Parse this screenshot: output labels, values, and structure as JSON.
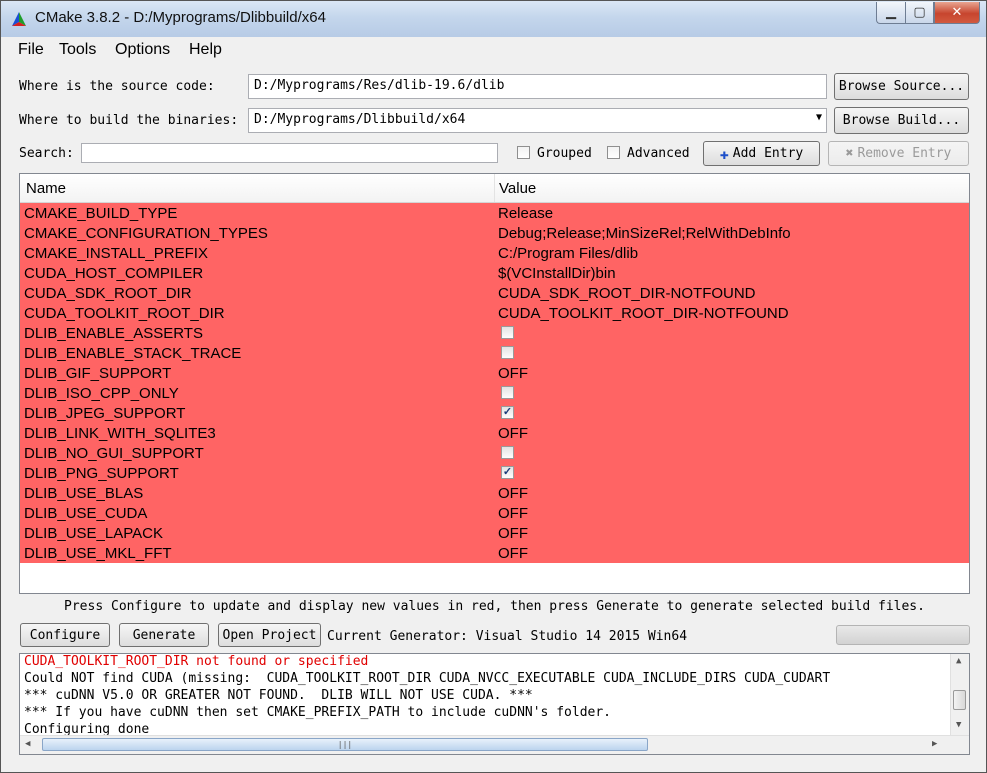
{
  "window": {
    "title": "CMake 3.8.2 - D:/Myprograms/Dlibbuild/x64"
  },
  "menu": [
    "File",
    "Tools",
    "Options",
    "Help"
  ],
  "source": {
    "label": "Where is the source code:",
    "value": "D:/Myprograms/Res/dlib-19.6/dlib",
    "button": "Browse Source..."
  },
  "build": {
    "label": "Where to build the binaries:",
    "value": "D:/Myprograms/Dlibbuild/x64",
    "button": "Browse Build..."
  },
  "search": {
    "label": "Search:",
    "value": ""
  },
  "options": {
    "grouped": "Grouped",
    "advanced": "Advanced",
    "add_entry": "Add Entry",
    "remove_entry": "Remove Entry"
  },
  "table": {
    "headers": {
      "name": "Name",
      "value": "Value"
    },
    "rows": [
      {
        "name": "CMAKE_BUILD_TYPE",
        "value": "Release"
      },
      {
        "name": "CMAKE_CONFIGURATION_TYPES",
        "value": "Debug;Release;MinSizeRel;RelWithDebInfo"
      },
      {
        "name": "CMAKE_INSTALL_PREFIX",
        "value": "C:/Program Files/dlib"
      },
      {
        "name": "CUDA_HOST_COMPILER",
        "value": "$(VCInstallDir)bin"
      },
      {
        "name": "CUDA_SDK_ROOT_DIR",
        "value": "CUDA_SDK_ROOT_DIR-NOTFOUND"
      },
      {
        "name": "CUDA_TOOLKIT_ROOT_DIR",
        "value": "CUDA_TOOLKIT_ROOT_DIR-NOTFOUND"
      },
      {
        "name": "DLIB_ENABLE_ASSERTS",
        "checkbox": true,
        "checked": false
      },
      {
        "name": "DLIB_ENABLE_STACK_TRACE",
        "checkbox": true,
        "checked": false
      },
      {
        "name": "DLIB_GIF_SUPPORT",
        "value": "OFF"
      },
      {
        "name": "DLIB_ISO_CPP_ONLY",
        "checkbox": true,
        "checked": false
      },
      {
        "name": "DLIB_JPEG_SUPPORT",
        "checkbox": true,
        "checked": true
      },
      {
        "name": "DLIB_LINK_WITH_SQLITE3",
        "value": "OFF"
      },
      {
        "name": "DLIB_NO_GUI_SUPPORT",
        "checkbox": true,
        "checked": false
      },
      {
        "name": "DLIB_PNG_SUPPORT",
        "checkbox": true,
        "checked": true
      },
      {
        "name": "DLIB_USE_BLAS",
        "value": "OFF"
      },
      {
        "name": "DLIB_USE_CUDA",
        "value": "OFF"
      },
      {
        "name": "DLIB_USE_LAPACK",
        "value": "OFF"
      },
      {
        "name": "DLIB_USE_MKL_FFT",
        "value": "OFF"
      }
    ]
  },
  "hint": "Press Configure to update and display new values in red, then press Generate to generate selected build files.",
  "actions": {
    "configure": "Configure",
    "generate": "Generate",
    "open_project": "Open Project"
  },
  "generator": "Current Generator: Visual Studio 14 2015 Win64",
  "log": [
    {
      "text": "CUDA_TOOLKIT_ROOT_DIR not found or specified",
      "error": true
    },
    {
      "text": "Could NOT find CUDA (missing:  CUDA_TOOLKIT_ROOT_DIR CUDA_NVCC_EXECUTABLE CUDA_INCLUDE_DIRS CUDA_CUDART",
      "error": false
    },
    {
      "text": "*** cuDNN V5.0 OR GREATER NOT FOUND.  DLIB WILL NOT USE CUDA. ***",
      "error": false
    },
    {
      "text": "*** If you have cuDNN then set CMAKE_PREFIX_PATH to include cuDNN's folder.",
      "error": false
    },
    {
      "text": "Configuring done",
      "error": false
    }
  ],
  "colors": {
    "changed_row": "#ff6464",
    "error_text": "#e00000"
  }
}
